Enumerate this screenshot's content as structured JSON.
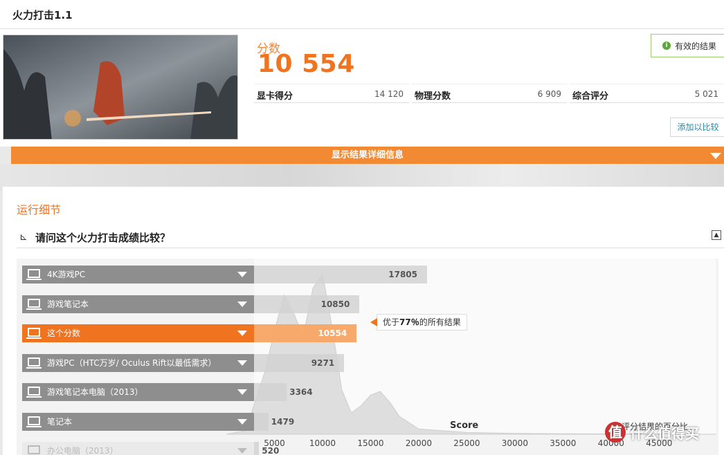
{
  "header": {
    "title": "火力打击1.1"
  },
  "result": {
    "score_label": "分数",
    "score_value": "10 554",
    "valid_label": "有效的结果",
    "valid_icon": "info-icon",
    "subscores": [
      {
        "label": "显卡得分",
        "value": "14 120"
      },
      {
        "label": "物理分数",
        "value": "6 909"
      },
      {
        "label": "综合评分",
        "value": "5 021"
      }
    ],
    "compare_button": "添加以比较"
  },
  "details_bar": {
    "label": "显示结果详细信息"
  },
  "run_details": {
    "section_title": "运行细节",
    "question": "请问这个火力打击成绩比较？",
    "rows": [
      {
        "label": "4K游戏PC",
        "value": "17805",
        "icon": "monitor-icon"
      },
      {
        "label": "游戏笔记本",
        "value": "10850",
        "icon": "laptop-icon"
      },
      {
        "label": "这个分数",
        "value": "10554",
        "icon": "trophy-icon",
        "highlight": true
      },
      {
        "label": "游戏PC（HTC万岁/ Oculus Rift以最低需求）",
        "value": "9271",
        "icon": "monitor-icon"
      },
      {
        "label": "游戏笔记本电脑（2013）",
        "value": "3364",
        "icon": "laptop-icon"
      },
      {
        "label": "笔记本",
        "value": "1479",
        "icon": "laptop-icon"
      },
      {
        "label": "办公电脑（2013）",
        "value": "520",
        "icon": "monitor-icon",
        "faded": true
      }
    ],
    "callout": {
      "prefix": "优于",
      "percent": "77％",
      "suffix": "的所有结果"
    },
    "axis_title": "Score",
    "percent_note": "每评分结果的百分比。",
    "ticks": [
      "5000",
      "10000",
      "15000",
      "20000",
      "25000",
      "30000",
      "35000",
      "40000",
      "45000"
    ]
  },
  "chart_data": {
    "type": "area",
    "title": "",
    "xlabel": "Score",
    "ylabel": "每评分结果的百分比。",
    "xlim": [
      0,
      48000
    ],
    "x": [
      0,
      2000,
      4000,
      5000,
      6000,
      7000,
      8000,
      9000,
      10000,
      11000,
      12000,
      13000,
      14000,
      15000,
      16000,
      17000,
      18000,
      20000,
      25000,
      30000,
      35000,
      40000,
      45000
    ],
    "y": [
      0,
      2,
      35,
      58,
      78,
      68,
      55,
      82,
      90,
      60,
      25,
      12,
      16,
      22,
      24,
      18,
      10,
      3,
      1,
      0.5,
      0.3,
      0.2,
      0.1
    ],
    "series": [
      {
        "name": "4K游戏PC",
        "values": [
          17805
        ]
      },
      {
        "name": "游戏笔记本",
        "values": [
          10850
        ]
      },
      {
        "name": "这个分数",
        "values": [
          10554
        ]
      },
      {
        "name": "游戏PC（HTC万岁/ Oculus Rift以最低需求）",
        "values": [
          9271
        ]
      },
      {
        "name": "游戏笔记本电脑（2013）",
        "values": [
          3364
        ]
      },
      {
        "name": "笔记本",
        "values": [
          1479
        ]
      },
      {
        "name": "办公电脑（2013）",
        "values": [
          520
        ]
      }
    ]
  },
  "colors": {
    "accent": "#f0731f",
    "valid": "#5da63b",
    "link": "#1f8bb0"
  },
  "watermark": {
    "text": "什么值得买",
    "icon": "value-logo-icon"
  }
}
